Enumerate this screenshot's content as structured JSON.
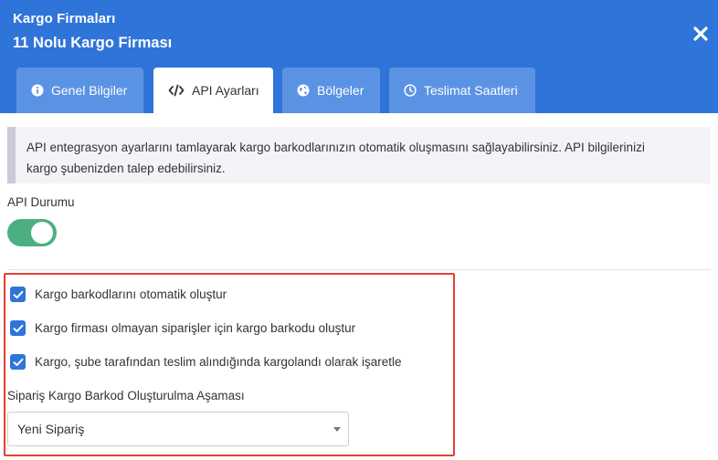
{
  "header": {
    "title": "Kargo Firmaları",
    "subtitle": "11 Nolu Kargo Firması"
  },
  "colors": {
    "header_bg": "#2f74d9",
    "tab_inactive_bg": "#5b93e4",
    "toggle_on": "#4caf82",
    "checkbox": "#2f74d9",
    "highlight_border": "#e4402f"
  },
  "tabs": [
    {
      "label": "Genel Bilgiler",
      "icon": "info-circle-icon",
      "active": false
    },
    {
      "label": "API Ayarları",
      "icon": "code-icon",
      "active": true
    },
    {
      "label": "Bölgeler",
      "icon": "globe-icon",
      "active": false
    },
    {
      "label": "Teslimat Saatleri",
      "icon": "clock-icon",
      "active": false
    }
  ],
  "info": {
    "line1": "API entegrasyon ayarlarını tamlayarak kargo barkodlarınızın otomatik oluşmasını sağlayabilirsiniz. API bilgilerinizi",
    "line2": "kargo şubenizden talep edebilirsiniz."
  },
  "api_status": {
    "label": "API Durumu",
    "enabled": true
  },
  "options": [
    {
      "label": "Kargo barkodlarını otomatik oluştur",
      "checked": true
    },
    {
      "label": "Kargo firması olmayan siparişler için kargo barkodu oluştur",
      "checked": true
    },
    {
      "label": "Kargo, şube tarafından teslim alındığında kargolandı olarak işaretle",
      "checked": true
    }
  ],
  "stage": {
    "label": "Sipariş Kargo Barkod Oluşturulma Aşaması",
    "selected": "Yeni Sipariş"
  }
}
